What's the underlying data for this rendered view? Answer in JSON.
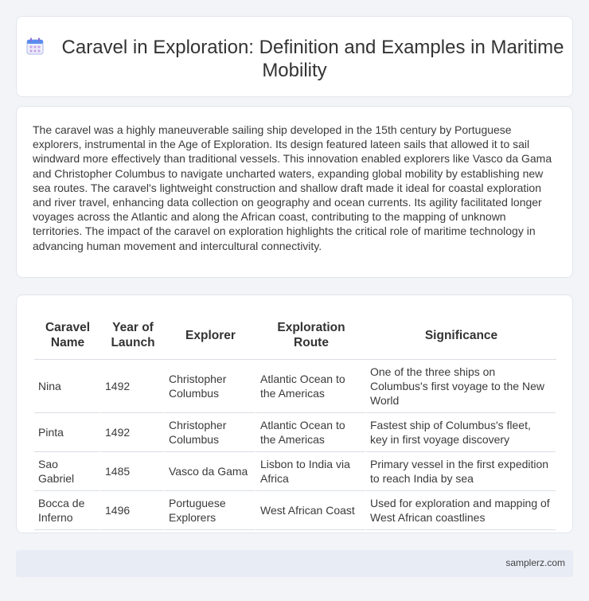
{
  "header": {
    "icon": "calendar-icon",
    "title": "Caravel in Exploration: Definition and Examples in Maritime Mobility"
  },
  "summary": {
    "text": "The caravel was a highly maneuverable sailing ship developed in the 15th century by Portuguese explorers, instrumental in the Age of Exploration. Its design featured lateen sails that allowed it to sail windward more effectively than traditional vessels. This innovation enabled explorers like Vasco da Gama and Christopher Columbus to navigate uncharted waters, expanding global mobility by establishing new sea routes. The caravel's lightweight construction and shallow draft made it ideal for coastal exploration and river travel, enhancing data collection on geography and ocean currents. Its agility facilitated longer voyages across the Atlantic and along the African coast, contributing to the mapping of unknown territories. The impact of the caravel on exploration highlights the critical role of maritime technology in advancing human movement and intercultural connectivity."
  },
  "table": {
    "headers": [
      "Caravel Name",
      "Year of Launch",
      "Explorer",
      "Exploration Route",
      "Significance"
    ],
    "rows": [
      [
        "Nina",
        "1492",
        "Christopher Columbus",
        "Atlantic Ocean to the Americas",
        "One of the three ships on Columbus's first voyage to the New World"
      ],
      [
        "Pinta",
        "1492",
        "Christopher Columbus",
        "Atlantic Ocean to the Americas",
        "Fastest ship of Columbus's fleet, key in first voyage discovery"
      ],
      [
        "Sao Gabriel",
        "1485",
        "Vasco da Gama",
        "Lisbon to India via Africa",
        "Primary vessel in the first expedition to reach India by sea"
      ],
      [
        "Bocca de Inferno",
        "1496",
        "Portuguese Explorers",
        "West African Coast",
        "Used for exploration and mapping of West African coastlines"
      ]
    ]
  },
  "footer": {
    "site": "samplerz.com"
  },
  "colors": {
    "background": "#f2f4f8",
    "card": "#ffffff",
    "footer": "#e8ecf5",
    "icon_accent": "#5b8def"
  }
}
